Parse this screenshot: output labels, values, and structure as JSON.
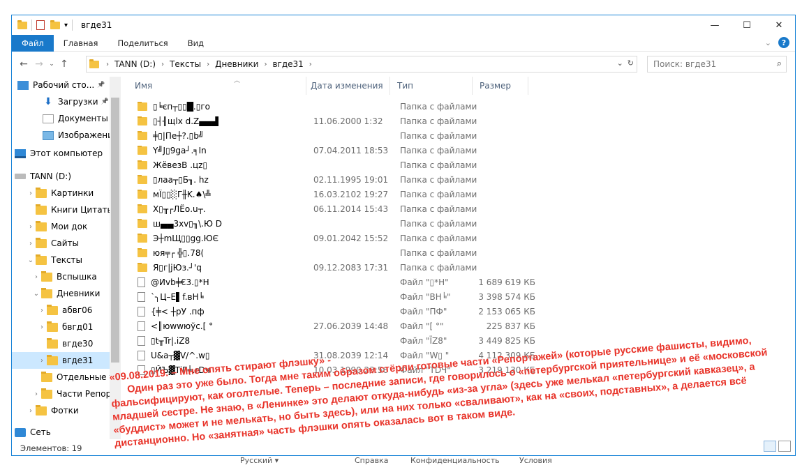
{
  "window": {
    "title": "вгде31",
    "controls": {
      "minimize": "—",
      "maximize": "☐",
      "close": "✕"
    }
  },
  "ribbon": {
    "tabs": [
      "Файл",
      "Главная",
      "Поделиться",
      "Вид"
    ],
    "help": "?"
  },
  "address": {
    "crumbs": [
      "TANN (D:)",
      "Тексты",
      "Дневники",
      "вгде31"
    ]
  },
  "search": {
    "placeholder": "Поиск: вгде31"
  },
  "nav_pane": {
    "items": [
      {
        "label": "Рабочий сто...",
        "icon": "desktop-icon",
        "pinned": true
      },
      {
        "label": "Загрузки",
        "icon": "download-icon",
        "pinned": true
      },
      {
        "label": "Документы",
        "icon": "documents-icon",
        "pinned": true
      },
      {
        "label": "Изображени",
        "icon": "pictures-icon",
        "pinned": true
      },
      {
        "label": "Этот компьютер",
        "icon": "computer-icon"
      },
      {
        "label": "TANN (D:)",
        "icon": "drive-icon"
      },
      {
        "label": "Картинки",
        "icon": "folder-icon"
      },
      {
        "label": "Книги Цитаты С",
        "icon": "folder-icon"
      },
      {
        "label": "Мои док",
        "icon": "folder-icon"
      },
      {
        "label": "Сайты",
        "icon": "folder-icon"
      },
      {
        "label": "Тексты",
        "icon": "folder-icon"
      },
      {
        "label": "Вспышка",
        "icon": "folder-icon"
      },
      {
        "label": "Дневники",
        "icon": "folder-icon"
      },
      {
        "label": "абвг06",
        "icon": "folder-icon"
      },
      {
        "label": "бвгд01",
        "icon": "folder-icon"
      },
      {
        "label": "вгде30",
        "icon": "folder-icon"
      },
      {
        "label": "вгде31",
        "icon": "folder-icon"
      },
      {
        "label": "Отдельные тек",
        "icon": "folder-icon"
      },
      {
        "label": "Части Репорта",
        "icon": "folder-icon"
      },
      {
        "label": "Фотки",
        "icon": "folder-icon"
      },
      {
        "label": "Сеть",
        "icon": "network-icon"
      }
    ]
  },
  "columns": {
    "name": "Имя",
    "date": "Дата изменения",
    "type": "Тип",
    "size": "Размер"
  },
  "files": [
    {
      "kind": "folder",
      "name": "▯╘єп┬▯▯█.▯го",
      "date": "",
      "type": "Папка с файлами",
      "size": ""
    },
    {
      "kind": "folder",
      "name": "▯┤╢щlх d.Z▄▄▟",
      "date": "11.06.2000 1:32",
      "type": "Папка с файлами",
      "size": ""
    },
    {
      "kind": "folder",
      "name": "╪▯|Пе┼?.▯b╝",
      "date": "",
      "type": "Папка с файлами",
      "size": ""
    },
    {
      "kind": "folder",
      "name": "Y╝J▯9gа┘.╕In",
      "date": "07.04.2011 18:53",
      "type": "Папка с файлами",
      "size": ""
    },
    {
      "kind": "folder",
      "name": "ЖёвезВ .цz▯",
      "date": "",
      "type": "Папка с файлами",
      "size": ""
    },
    {
      "kind": "folder",
      "name": "▯лаа┬▯Б╖. hz",
      "date": "02.11.1995 19:01",
      "type": "Папка с файлами",
      "size": ""
    },
    {
      "kind": "folder",
      "name": "мÏ▯▯░Γ╫K.♠\\╩",
      "date": "16.03.2102 19:27",
      "type": "Папка с файлами",
      "size": ""
    },
    {
      "kind": "folder",
      "name": "Х▯╥┌ЛЁо.u┬.",
      "date": "06.11.2014 15:43",
      "type": "Папка с файлами",
      "size": ""
    },
    {
      "kind": "folder",
      "name": "ш▄▄3хv▯╖\\.Ю  D",
      "date": "",
      "type": "Папка с файлами",
      "size": ""
    },
    {
      "kind": "folder",
      "name": "Э┼mЩ▯▯gg.ЮЄ",
      "date": "09.01.2042 15:52",
      "type": "Папка с файлами",
      "size": ""
    },
    {
      "kind": "folder",
      "name": "юя╤┌ ╬▯.78(",
      "date": "",
      "type": "Папка с файлами",
      "size": ""
    },
    {
      "kind": "folder",
      "name": "Я▯г|jЮз.┘'q",
      "date": "09.12.2083 17:31",
      "type": "Папка с файлами",
      "size": ""
    },
    {
      "kind": "file",
      "name": "@Иvb╪€3.▯*H",
      "date": "",
      "type": "Файл \"▯*H\"",
      "size": "1 689 619 КБ"
    },
    {
      "kind": "file",
      "name": "`╮Ц–Е▌f.вН╘",
      "date": "",
      "type": "Файл \"ВН╘\"",
      "size": "3 398 574 КБ"
    },
    {
      "kind": "file",
      "name": "{╪< ┼рУ .пф",
      "date": "",
      "type": "Файл \"ПФ\"",
      "size": "2 153 065 КБ"
    },
    {
      "kind": "file",
      "name": "<║юwwюўс.[ °",
      "date": "27.06.2039 14:48",
      "type": "Файл \"[ °\"",
      "size": "225 837 КБ"
    },
    {
      "kind": "file",
      "name": "▯t╥Tr|.iZ8",
      "date": "",
      "type": "Файл \"ÏZ8\"",
      "size": "3 449 825 КБ"
    },
    {
      "kind": "file",
      "name": "U&а┬▓V/^.w▯",
      "date": "31.08.2039 12:14",
      "type": "Файл \"W▯  \"",
      "size": "4 112 309 КБ"
    },
    {
      "kind": "file",
      "name": "▯ЙЪ▓TiГ╪.rDч",
      "date": "10.03.1990 23:56",
      "type": "Файл \"TDЧ\"",
      "size": "3 219 130 КБ"
    }
  ],
  "status": {
    "count": "Элементов: 19"
  },
  "overlay_text": "«09.08.2019. – Мне опять стирают флэшку» -\n      Один раз это уже было. Тогда мне таким образом стёрли готовые части «Репортажей» (которые русские фашисты, видимо,\nфальсифицируют, как оголтелые. Теперь – последние записи, где говорилось о «петербургской приятельнице» и её «московской\nмладшей сестре. Не знаю, в «Ленинке» это делают откуда-нибудь «из-за угла» (здесь уже мелькал «петербургский кавказец», а\n«буддист» может и не мелькать, но быть здесь), или на них только «сваливают», как на «своих, подставных», а делается всё\nдистанционно. Но «занятная» часть флэшки опять оказалась вот в таком виде.",
  "footer": {
    "lang": "Русский",
    "help": "Справка",
    "privacy": "Конфиденциальность",
    "terms": "Условия"
  }
}
